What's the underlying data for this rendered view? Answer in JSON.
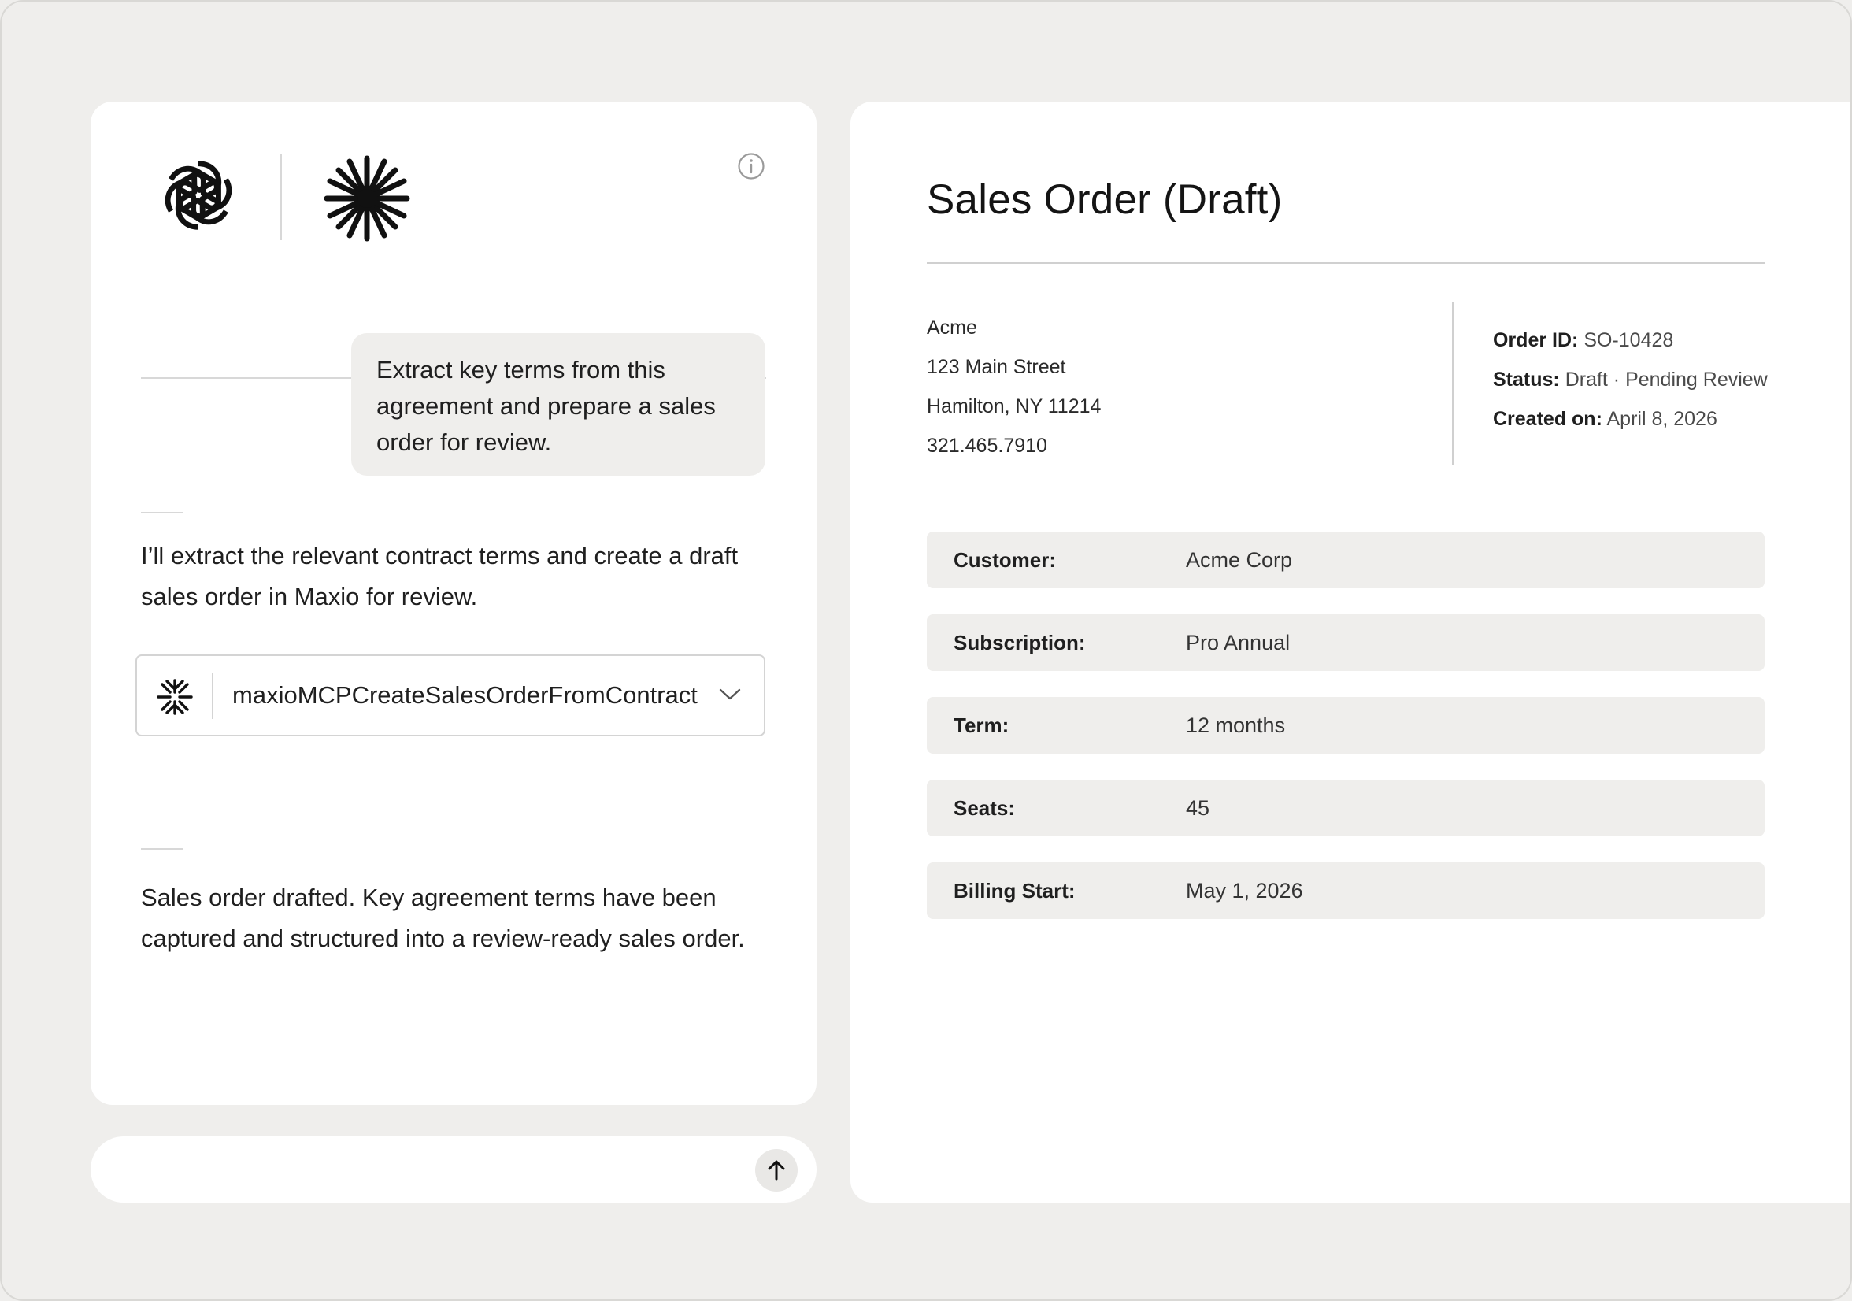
{
  "chat": {
    "user_message": "Extract key terms from this agreement and prepare a sales order for review.",
    "assistant_intro": "I’ll extract the relevant contract terms and create a draft sales order in Maxio for review.",
    "tool_call": {
      "name": "maxioMCPCreateSalesOrderFromContract",
      "icon": "maxio-asterisk-icon"
    },
    "assistant_result": "Sales order drafted. Key agreement terms have been captured and structured into a review-ready sales order.",
    "composer": {
      "placeholder": "",
      "value": ""
    }
  },
  "document": {
    "title": "Sales Order (Draft)",
    "address": {
      "company": "Acme",
      "street": "123 Main Street",
      "city_line": "Hamilton, NY 11214",
      "phone": "321.465.7910"
    },
    "meta": {
      "order_id_label": "Order ID:",
      "order_id": "SO-10428",
      "status_label": "Status:",
      "status": "Draft · Pending Review",
      "created_label": "Created on:",
      "created": "April 8, 2026"
    },
    "fields": [
      {
        "label": "Customer:",
        "value": "Acme Corp"
      },
      {
        "label": "Subscription:",
        "value": "Pro Annual"
      },
      {
        "label": "Term:",
        "value": "12 months"
      },
      {
        "label": "Seats:",
        "value": "45"
      },
      {
        "label": "Billing Start:",
        "value": "May 1, 2026"
      }
    ]
  },
  "colors": {
    "background": "#efeeec",
    "panel": "#ffffff",
    "field_fill": "#efeeec",
    "text": "#1f1f1f"
  }
}
